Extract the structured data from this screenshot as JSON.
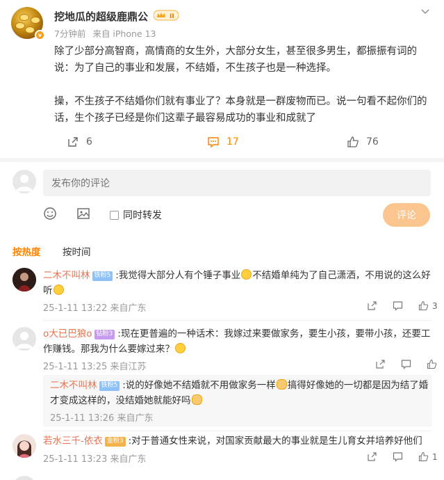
{
  "post": {
    "author": "挖地瓜的超级鹿鼎公",
    "time": "7分钟前",
    "source": "来自 iPhone 13",
    "paragraphs": [
      "除了少部分高智商，高情商的女生外，大部分女生，甚至很多男生，都振振有词的说：为了自己的事业和发展，不结婚，不生孩子也是一种选择。",
      "操，不生孩子不结婚你们就有事业了？本身就是一群废物而已。说一句看不起你们的话，生个孩子已经是你们这辈子最容易成功的事业和成就了"
    ],
    "reposts": "6",
    "comments": "17",
    "likes": "76",
    "vip_level": "II"
  },
  "composer": {
    "placeholder": "发布你的评论",
    "forward_label": "同时转发",
    "submit_label": "评论"
  },
  "sort": {
    "hot": "按热度",
    "time": "按时间"
  },
  "comments": [
    {
      "name": "二木不叫林",
      "badge": "铁粉5",
      "text_a": ":我觉得大部分人有个锤子事业",
      "text_b": "不结婚单纯为了自己潇洒，不用说的这么好听",
      "time": "25-1-11 13:22 来自广东",
      "likes": "3"
    },
    {
      "name": "o大已巴狼o",
      "badge": "钻粉3",
      "text_a": ":现在更普遍的一种话术：我嫁过来要做家务，要生小孩，要带小孩，还要工作赚钱。那我为什么要嫁过来？",
      "time": "25-1-11 13:25 来自江苏",
      "reply": {
        "name": "二木不叫林",
        "badge": "铁粉5",
        "text_a": ":说的好像她不结婚就不用做家务一样",
        "text_b": "搞得好像她的一切都是因为结了婚才变成这样的，没结婚她就能好吗",
        "time": "25-1-11 13:26 来自广东"
      }
    },
    {
      "name": "若水三千-依衣",
      "badge": "金粉3",
      "text_a": ":对于普通女性来说，对国家贡献最大的事业就是生儿育女并培养好他们",
      "time": "25-1-11 13:23 来自广东"
    }
  ],
  "colors": {
    "accent": "#ff8200",
    "name": "#eb7350",
    "submit_bg": "#fbc58f"
  }
}
